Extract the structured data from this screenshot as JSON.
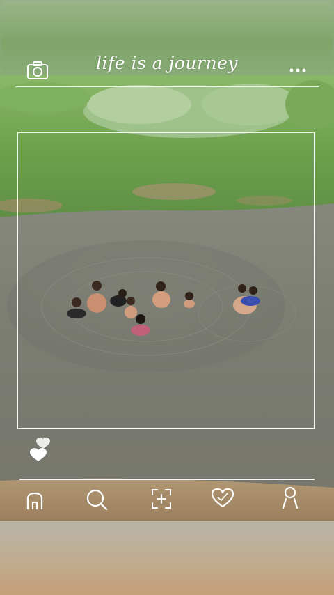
{
  "header": {
    "title": "life is a journey",
    "camera_icon": "camera-icon",
    "more_icon": "more-dots-icon"
  },
  "photo": {
    "description_icon": "photo"
  },
  "reaction": {
    "icon": "hearts-icon"
  },
  "bottom_nav": {
    "items": [
      {
        "icon": "home-icon"
      },
      {
        "icon": "search-icon"
      },
      {
        "icon": "add-frame-icon"
      },
      {
        "icon": "heart-icon"
      },
      {
        "icon": "profile-icon"
      }
    ]
  },
  "colors": {
    "foreground": "#ffffff",
    "grass": "#6fa24e",
    "water": "#7b7f76",
    "sand": "#a88d6b"
  }
}
